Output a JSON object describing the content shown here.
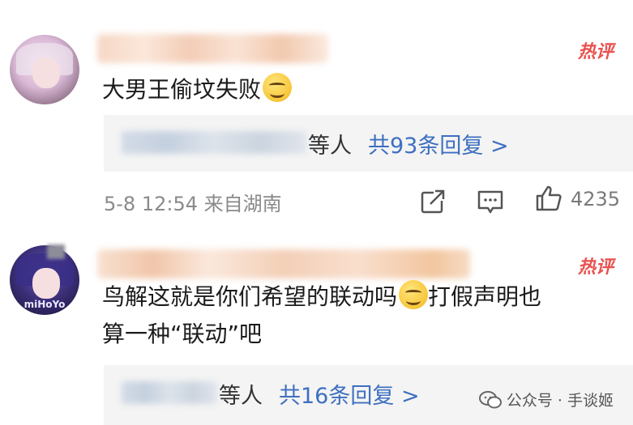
{
  "comments": [
    {
      "hot_badge": "热评",
      "text": "大男王偷坟失败",
      "emoji": "smile-emoji",
      "replies": {
        "label": "等人",
        "link": "共93条回复 >"
      },
      "meta": "5-8 12:54 来自湖南",
      "likes": "4235"
    },
    {
      "hot_badge": "热评",
      "avatar_brand": "miHoYo",
      "text_line1_a": "鸟解这就是你们希望的联动吗",
      "text_line1_b": "打假声明也",
      "text_line2": "算一种“联动”吧",
      "emoji": "grin-emoji",
      "replies": {
        "label": "等人",
        "link": "共16条回复 >"
      }
    }
  ],
  "watermark": {
    "text": "公众号 · 手谈姬"
  },
  "colors": {
    "hot": "#e8524f",
    "link": "#3e6fc0",
    "reply_bg": "#f4f4f4",
    "meta": "#8a8a8a"
  }
}
